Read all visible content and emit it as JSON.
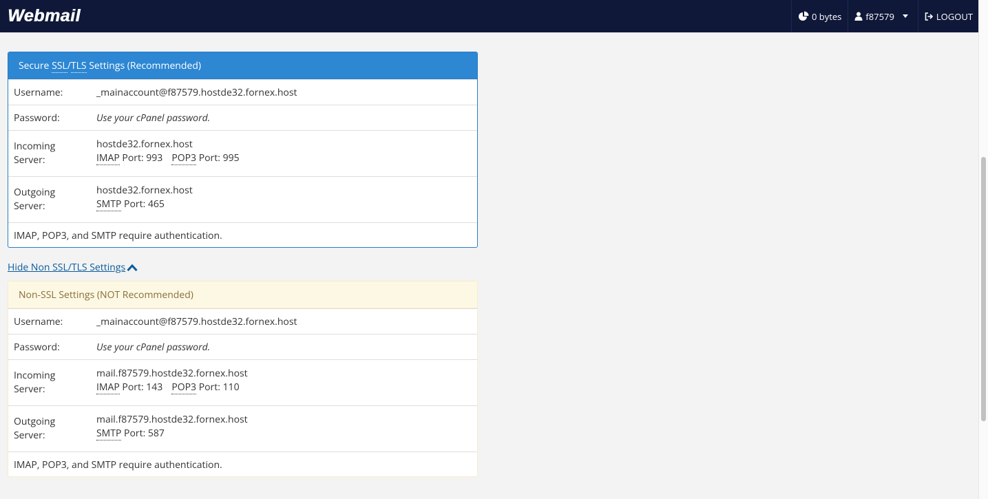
{
  "app": {
    "logo": "Webmail"
  },
  "topbar": {
    "quota": "0 bytes",
    "user": "f87579",
    "logout": "LOGOUT"
  },
  "ssl": {
    "title_pre": "Secure ",
    "title_abbr1": "SSL",
    "title_sep": "/",
    "title_abbr2": "TLS",
    "title_post": " Settings (Recommended)",
    "username_label": "Username:",
    "username": "_mainaccount@f87579.hostde32.fornex.host",
    "password_label": "Password:",
    "password": "Use your cPanel password.",
    "incoming_label_1": "Incoming",
    "incoming_label_2": "Server:",
    "incoming_host": "hostde32.fornex.host",
    "imap_abbr": "IMAP",
    "imap_port": " Port: 993",
    "pop3_abbr": "POP3",
    "pop3_port": " Port: 995",
    "outgoing_label_1": "Outgoing",
    "outgoing_label_2": "Server:",
    "outgoing_host": "hostde32.fornex.host",
    "smtp_abbr": "SMTP",
    "smtp_port": " Port: 465",
    "note": "IMAP, POP3, and SMTP require authentication."
  },
  "toggle": {
    "label": "Hide Non SSL/TLS Settings "
  },
  "nonssl": {
    "title": "Non-SSL Settings (NOT Recommended)",
    "username_label": "Username:",
    "username": "_mainaccount@f87579.hostde32.fornex.host",
    "password_label": "Password:",
    "password": "Use your cPanel password.",
    "incoming_label_1": "Incoming",
    "incoming_label_2": "Server:",
    "incoming_host": "mail.f87579.hostde32.fornex.host",
    "imap_abbr": "IMAP",
    "imap_port": " Port: 143",
    "pop3_abbr": "POP3",
    "pop3_port": " Port: 110",
    "outgoing_label_1": "Outgoing",
    "outgoing_label_2": "Server:",
    "outgoing_host": "mail.f87579.hostde32.fornex.host",
    "smtp_abbr": "SMTP",
    "smtp_port": " Port: 587",
    "note": "IMAP, POP3, and SMTP require authentication."
  },
  "colors": {
    "topbar": "#0f1839",
    "ssl_header": "#2d87d3",
    "warn_header": "#fcf8e3",
    "link": "#095a9b"
  },
  "icons": [
    "pie-chart-icon",
    "user-icon",
    "caret-down-icon",
    "logout-icon",
    "chevron-up-icon"
  ]
}
